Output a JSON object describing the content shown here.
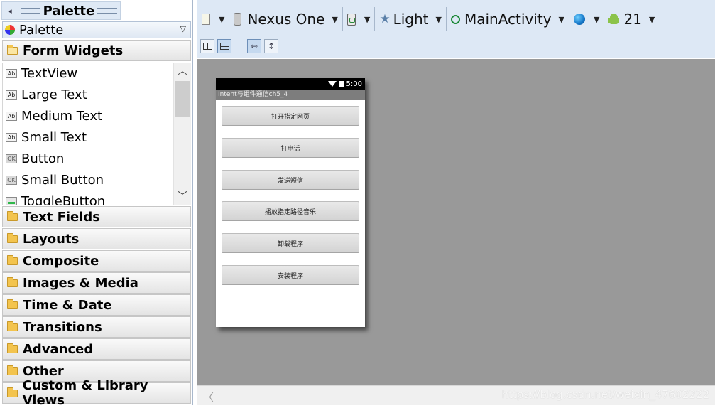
{
  "palette": {
    "title": "Palette",
    "dropdown_label": "Palette",
    "open_category": "Form Widgets",
    "widgets": [
      {
        "label": "TextView",
        "icon": "ab-icon"
      },
      {
        "label": "Large Text",
        "icon": "ab-icon"
      },
      {
        "label": "Medium Text",
        "icon": "ab-icon"
      },
      {
        "label": "Small Text",
        "icon": "ab-icon"
      },
      {
        "label": "Button",
        "icon": "ok-icon"
      },
      {
        "label": "Small Button",
        "icon": "ok-icon"
      },
      {
        "label": "ToggleButton",
        "icon": "toggle-icon"
      }
    ],
    "categories": [
      "Text Fields",
      "Layouts",
      "Composite",
      "Images & Media",
      "Time & Date",
      "Transitions",
      "Advanced",
      "Other",
      "Custom & Library Views"
    ]
  },
  "toolbar": {
    "device": "Nexus One",
    "theme": "Light",
    "activity": "MainActivity",
    "api_level": "21"
  },
  "preview": {
    "status_time": "5:00",
    "app_title": "Intent与组件通信ch5_4",
    "buttons": [
      "打开指定网页",
      "打电话",
      "发送短信",
      "播放指定路径音乐",
      "卸载程序",
      "安装程序"
    ]
  },
  "watermark": "https://blog.csdn.net/weixin_47602222",
  "colors": {
    "toolbar_bg": "#dde8f5",
    "canvas_bg": "#999999",
    "folder": "#f3c44e",
    "android_green": "#8bc34a"
  }
}
